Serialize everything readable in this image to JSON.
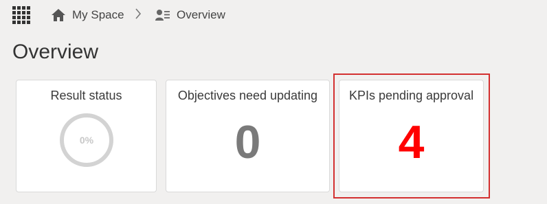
{
  "breadcrumb": {
    "home_label": "My Space",
    "separator": "›",
    "current_label": "Overview"
  },
  "page": {
    "title": "Overview"
  },
  "cards": {
    "result_status": {
      "title": "Result status",
      "percent_label": "0%",
      "percent_value": 0
    },
    "objectives": {
      "title": "Objectives need updating",
      "value": "0"
    },
    "kpis": {
      "title": "KPIs pending approval",
      "value": "4"
    }
  },
  "colors": {
    "objectives_number": "#7a7a7a",
    "kpis_number": "#ff0000",
    "highlight_border": "#d32f2f",
    "ring_gray": "#d3d3d3"
  },
  "icons": {
    "apps": "grid-icon",
    "home": "home-icon",
    "chevron": "chevron-right-icon",
    "overview": "user-list-icon"
  }
}
